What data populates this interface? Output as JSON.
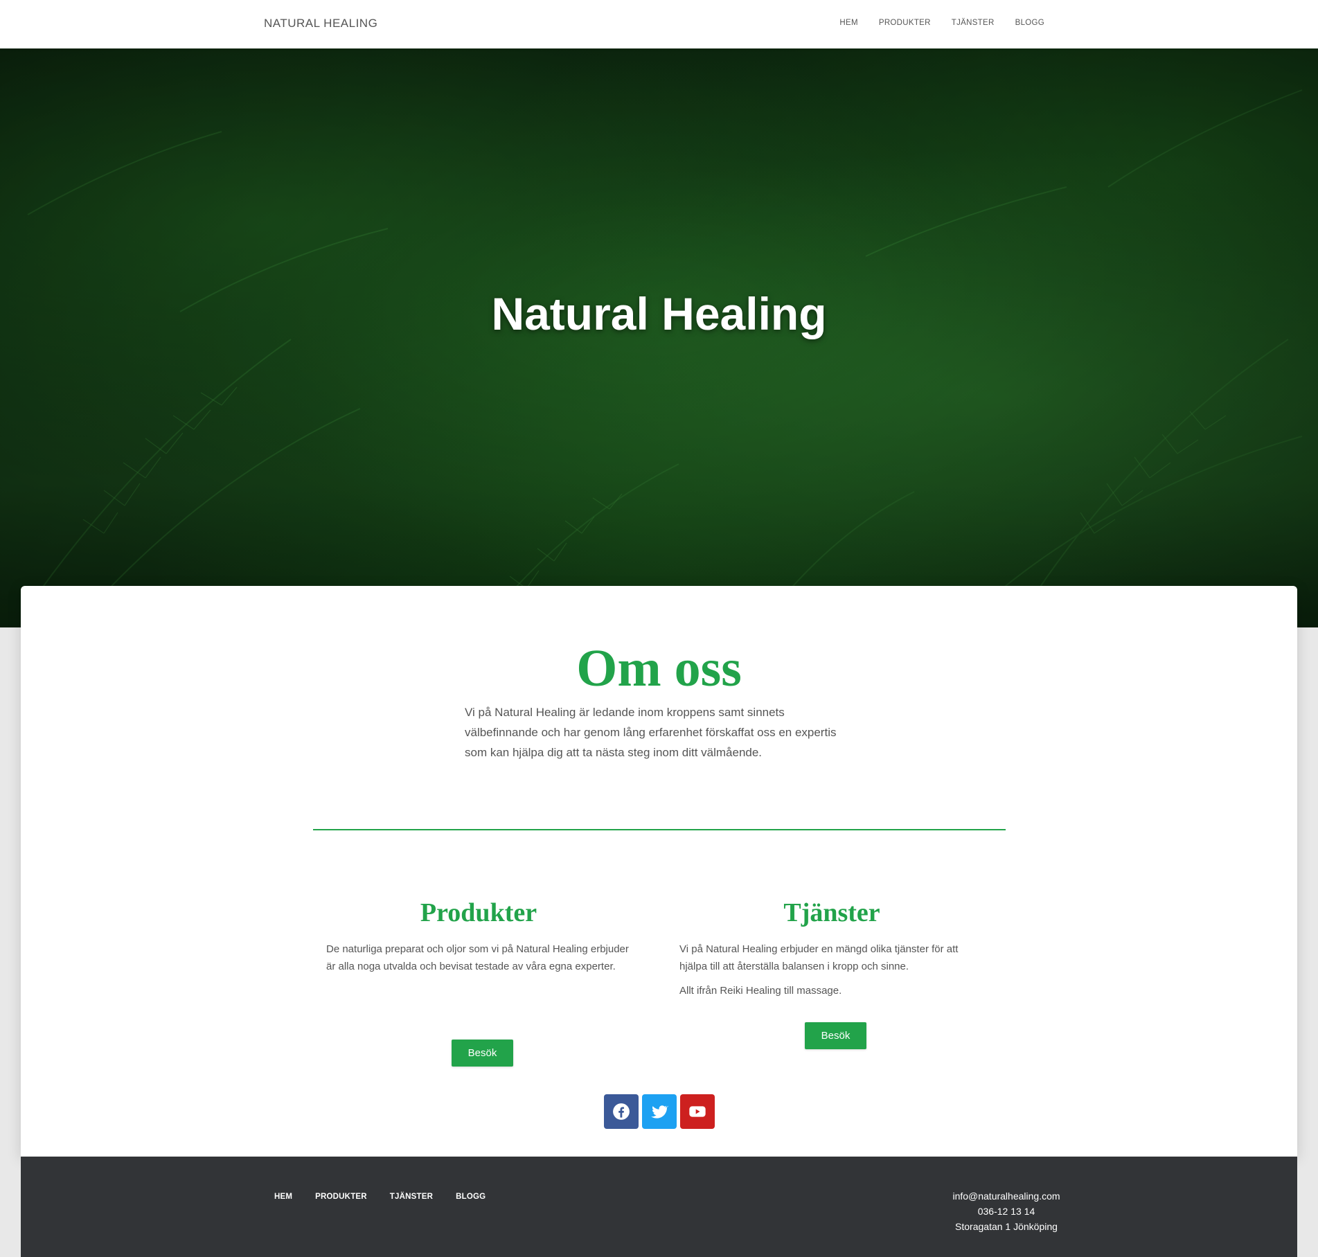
{
  "navbar": {
    "brand": "NATURAL HEALING",
    "items": [
      {
        "label": "HEM"
      },
      {
        "label": "PRODUKTER"
      },
      {
        "label": "TJÄNSTER"
      },
      {
        "label": "BLOGG"
      }
    ]
  },
  "hero": {
    "title": "Natural Healing"
  },
  "about": {
    "title": "Om oss",
    "text": "Vi på Natural Healing är ledande inom kroppens samt sinnets välbefinnande och har genom lång erfarenhet förskaffat oss en expertis som kan hjälpa dig  att ta nästa steg inom ditt välmående."
  },
  "products": {
    "title": "Produkter",
    "text": "De naturliga preparat och oljor som vi på Natural Healing erbjuder är alla noga utvalda och bevisat testade av våra egna experter.",
    "button_label": "Besök"
  },
  "services": {
    "title": "Tjänster",
    "text_1": "Vi på Natural Healing erbjuder en mängd olika tjänster för att hjälpa till att återställa balansen i kropp och sinne.",
    "text_2": "Allt ifrån Reiki Healing till massage.",
    "button_label": "Besök"
  },
  "social": {
    "items": [
      {
        "icon": "facebook-icon",
        "color": "#3b5998"
      },
      {
        "icon": "twitter-icon",
        "color": "#1da1f2"
      },
      {
        "icon": "youtube-icon",
        "color": "#cd201f"
      }
    ]
  },
  "footer": {
    "items": [
      {
        "label": "HEM"
      },
      {
        "label": "PRODUKTER"
      },
      {
        "label": "TJÄNSTER"
      },
      {
        "label": "BLOGG"
      }
    ],
    "email": "info@naturalhealing.com",
    "phone": "036-12 13 14",
    "address": "Storagatan 1 Jönköping"
  },
  "colors": {
    "accent": "#22a34a",
    "footer_bg": "#323437"
  }
}
